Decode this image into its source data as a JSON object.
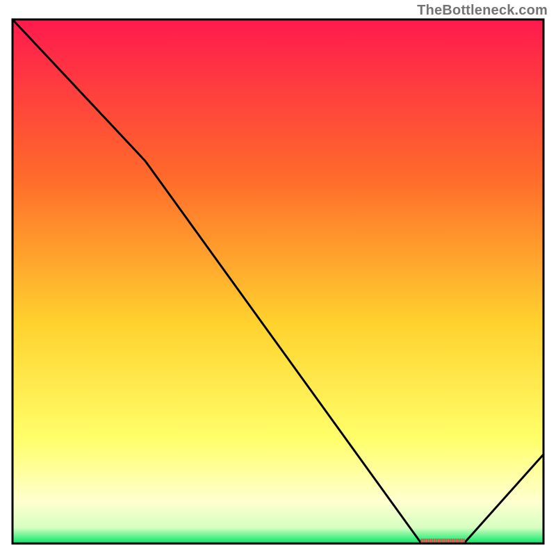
{
  "watermark": "TheBottleneck.com",
  "chart_data": {
    "type": "line",
    "title": "",
    "xlabel": "",
    "ylabel": "",
    "xlim": [
      0,
      100
    ],
    "ylim": [
      0,
      100
    ],
    "series": [
      {
        "name": "bottleneck-curve",
        "x": [
          0,
          25,
          77,
          85,
          100
        ],
        "y": [
          100,
          73,
          0,
          0,
          17
        ]
      }
    ],
    "annotations": [
      {
        "name": "optimal-range-marker",
        "x0": 77,
        "x1": 85,
        "y": 0
      }
    ],
    "background_gradient": [
      "#ff1a4e",
      "#ff6a2b",
      "#ffd22e",
      "#ffff6a",
      "#ffffcf",
      "#00e765"
    ],
    "frame": {
      "stroke": "#000000",
      "fill": "none"
    }
  },
  "colors": {
    "curve": "#000000",
    "marker": "#d8584d",
    "frame": "#000000"
  }
}
